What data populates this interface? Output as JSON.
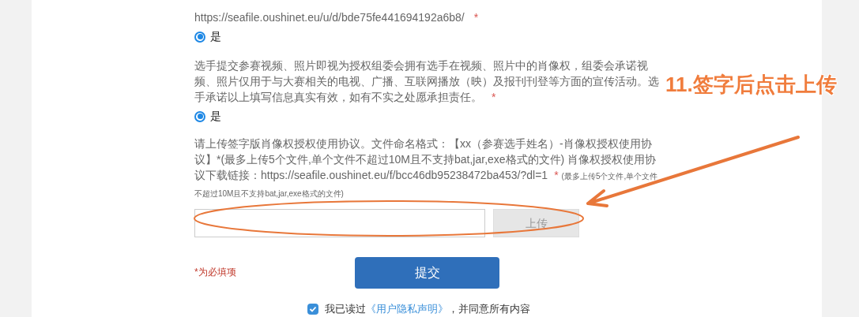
{
  "questions": [
    {
      "text": "https://seafile.oushinet.eu/u/d/bde75fe441694192a6b8/",
      "required_mark": "*",
      "options": [
        {
          "label": "是",
          "selected": true
        }
      ]
    },
    {
      "text": "选手提交参赛视频、照片即视为授权组委会拥有选手在视频、照片中的肖像权，组委会承诺视频、照片仅用于与大赛相关的电视、广播、互联网播放（映）及报刊刊登等方面的宣传活动。选手承诺以上填写信息真实有效，如有不实之处愿承担责任。",
      "required_mark": "*",
      "options": [
        {
          "label": "是",
          "selected": true
        }
      ]
    }
  ],
  "upload": {
    "text": "请上传签字版肖像权授权使用协议。文件命名格式：【xx（参赛选手姓名）-肖像权授权使用协议】*(最多上传5个文件,单个文件不超过10M且不支持bat,jar,exe格式的文件) 肖像权授权使用协议下载链接：https://seafile.oushinet.eu/f/bcc46db95238472ba453/?dl=1",
    "required_mark": "*",
    "note": "(最多上传5个文件,单个文件不超过10M且不支持bat,jar,exe格式的文件)",
    "button": "上传"
  },
  "required_note": "*为必填项",
  "submit": "提交",
  "agreement": {
    "checked": true,
    "before": "我已读过",
    "link": "《用户隐私声明》",
    "after": "，并同意所有内容"
  },
  "annotation": {
    "text": "11.签字后点击上传"
  }
}
